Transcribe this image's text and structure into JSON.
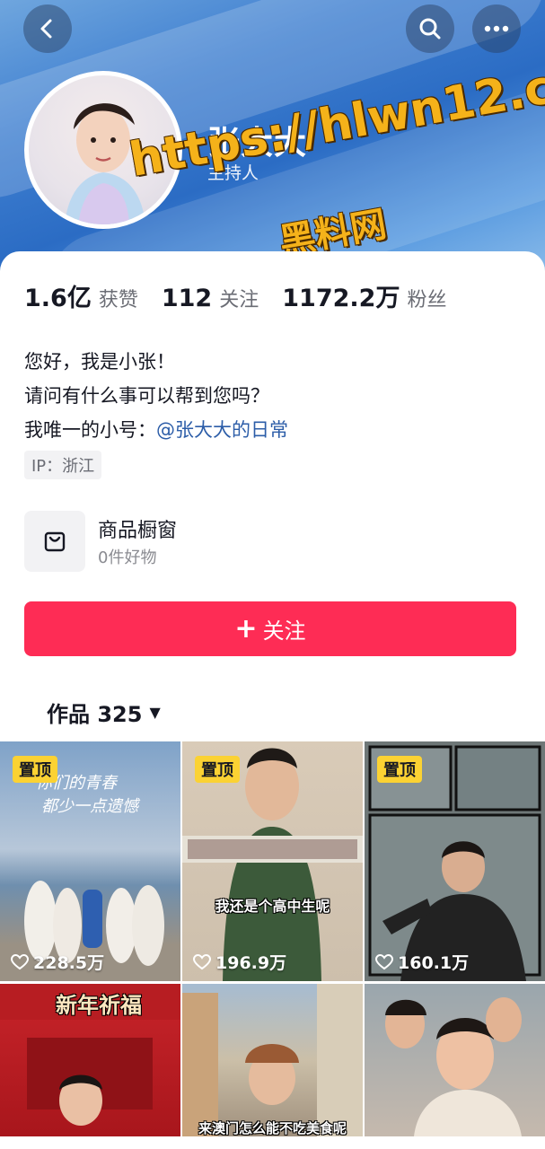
{
  "profile": {
    "name": "张大大",
    "role": "主持人",
    "watermark_url": "https://hlwn12.com",
    "watermark_label": "黑料网"
  },
  "stats": [
    {
      "value": "1.6亿",
      "label": "获赞"
    },
    {
      "value": "112",
      "label": "关注"
    },
    {
      "value": "1172.2万",
      "label": "粉丝"
    }
  ],
  "bio": {
    "line1": "您好，我是小张！",
    "line2": "请问有什么事可以帮到您吗？",
    "line3_prefix": "我唯一的小号：",
    "line3_mention": "@张大大的日常"
  },
  "ip_tag": "IP：浙江",
  "shop": {
    "title": "商品橱窗",
    "subtitle": "0件好物"
  },
  "follow_button": "关注",
  "works": {
    "label": "作品 325"
  },
  "videos": [
    {
      "pinned": "置顶",
      "likes": "228.5万",
      "caption": ""
    },
    {
      "pinned": "置顶",
      "likes": "196.9万",
      "caption": "我还是个高中生呢"
    },
    {
      "pinned": "置顶",
      "likes": "160.1万",
      "caption": ""
    },
    {
      "pinned": "",
      "likes": "",
      "caption": "新年祈福"
    },
    {
      "pinned": "",
      "likes": "",
      "caption": "来澳门怎么能不吃美食呢"
    },
    {
      "pinned": "",
      "likes": "",
      "caption": ""
    }
  ],
  "colors": {
    "accent": "#fe2c55",
    "pin": "#fbd233",
    "mention": "#2c5da8"
  },
  "icons": [
    "back-icon",
    "search-icon",
    "more-icon",
    "bag-icon",
    "heart-icon"
  ]
}
